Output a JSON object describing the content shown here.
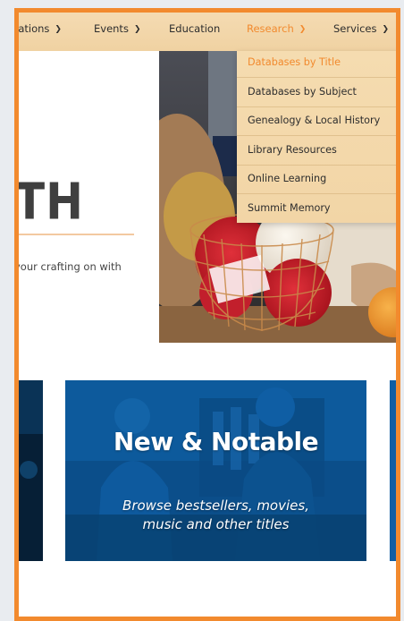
{
  "nav": {
    "items": [
      {
        "label": "cations",
        "chevron": true
      },
      {
        "label": "Events",
        "chevron": true
      },
      {
        "label": "Education",
        "chevron": false
      },
      {
        "label": "Research",
        "chevron": true
      },
      {
        "label": "Services",
        "chevron": true
      }
    ],
    "active_color": "#f28a2e"
  },
  "research_menu": {
    "items": [
      "Databases by Title",
      "Databases by Subject",
      "Genealogy & Local History",
      "Library Resources",
      "Online Learning",
      "Summit Memory"
    ]
  },
  "hero": {
    "heading_fragment": "TH",
    "text_fragment": "your crafting on with"
  },
  "promo": {
    "title": "New & Notable",
    "subtitle_line1": "Browse bestsellers, movies,",
    "subtitle_line2": "music and other titles"
  },
  "colors": {
    "frame": "#f28a2e",
    "nav_bg": "#f3d7aa",
    "card_blue": "#0a4f8c"
  }
}
